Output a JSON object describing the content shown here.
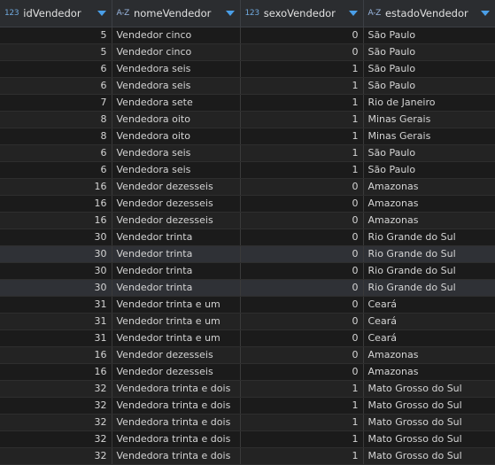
{
  "columns": [
    {
      "type_badge": "123",
      "label": "idVendedor"
    },
    {
      "type_badge": "A-Z",
      "label": "nomeVendedor"
    },
    {
      "type_badge": "123",
      "label": "sexoVendedor"
    },
    {
      "type_badge": "A-Z",
      "label": "estadoVendedor"
    }
  ],
  "rows": [
    [
      "5",
      "Vendedor cinco",
      "0",
      "São Paulo"
    ],
    [
      "5",
      "Vendedor cinco",
      "0",
      "São Paulo"
    ],
    [
      "6",
      "Vendedora seis",
      "1",
      "São Paulo"
    ],
    [
      "6",
      "Vendedora seis",
      "1",
      "São Paulo"
    ],
    [
      "7",
      "Vendedora sete",
      "1",
      "Rio de Janeiro"
    ],
    [
      "8",
      "Vendedora oito",
      "1",
      "Minas Gerais"
    ],
    [
      "8",
      "Vendedora oito",
      "1",
      "Minas Gerais"
    ],
    [
      "6",
      "Vendedora seis",
      "1",
      "São Paulo"
    ],
    [
      "6",
      "Vendedora seis",
      "1",
      "São Paulo"
    ],
    [
      "16",
      "Vendedor dezesseis",
      "0",
      "Amazonas"
    ],
    [
      "16",
      "Vendedor dezesseis",
      "0",
      "Amazonas"
    ],
    [
      "16",
      "Vendedor dezesseis",
      "0",
      "Amazonas"
    ],
    [
      "30",
      "Vendedor trinta",
      "0",
      "Rio Grande do Sul"
    ],
    [
      "30",
      "Vendedor trinta",
      "0",
      "Rio Grande do Sul"
    ],
    [
      "30",
      "Vendedor trinta",
      "0",
      "Rio Grande do Sul"
    ],
    [
      "30",
      "Vendedor trinta",
      "0",
      "Rio Grande do Sul"
    ],
    [
      "31",
      "Vendedor trinta e um",
      "0",
      "Ceará"
    ],
    [
      "31",
      "Vendedor trinta e um",
      "0",
      "Ceará"
    ],
    [
      "31",
      "Vendedor trinta e um",
      "0",
      "Ceará"
    ],
    [
      "16",
      "Vendedor dezesseis",
      "0",
      "Amazonas"
    ],
    [
      "16",
      "Vendedor dezesseis",
      "0",
      "Amazonas"
    ],
    [
      "32",
      "Vendedora trinta e dois",
      "1",
      "Mato Grosso do Sul"
    ],
    [
      "32",
      "Vendedora trinta e dois",
      "1",
      "Mato Grosso do Sul"
    ],
    [
      "32",
      "Vendedora trinta e dois",
      "1",
      "Mato Grosso do Sul"
    ],
    [
      "32",
      "Vendedora trinta e dois",
      "1",
      "Mato Grosso do Sul"
    ],
    [
      "32",
      "Vendedora trinta e dois",
      "1",
      "Mato Grosso do Sul"
    ]
  ],
  "colors": {
    "background": "#1e1e1e",
    "header_background": "#2b2d30",
    "sort_icon": "#4a9fe8",
    "type_badge": "#6fa8dc"
  }
}
